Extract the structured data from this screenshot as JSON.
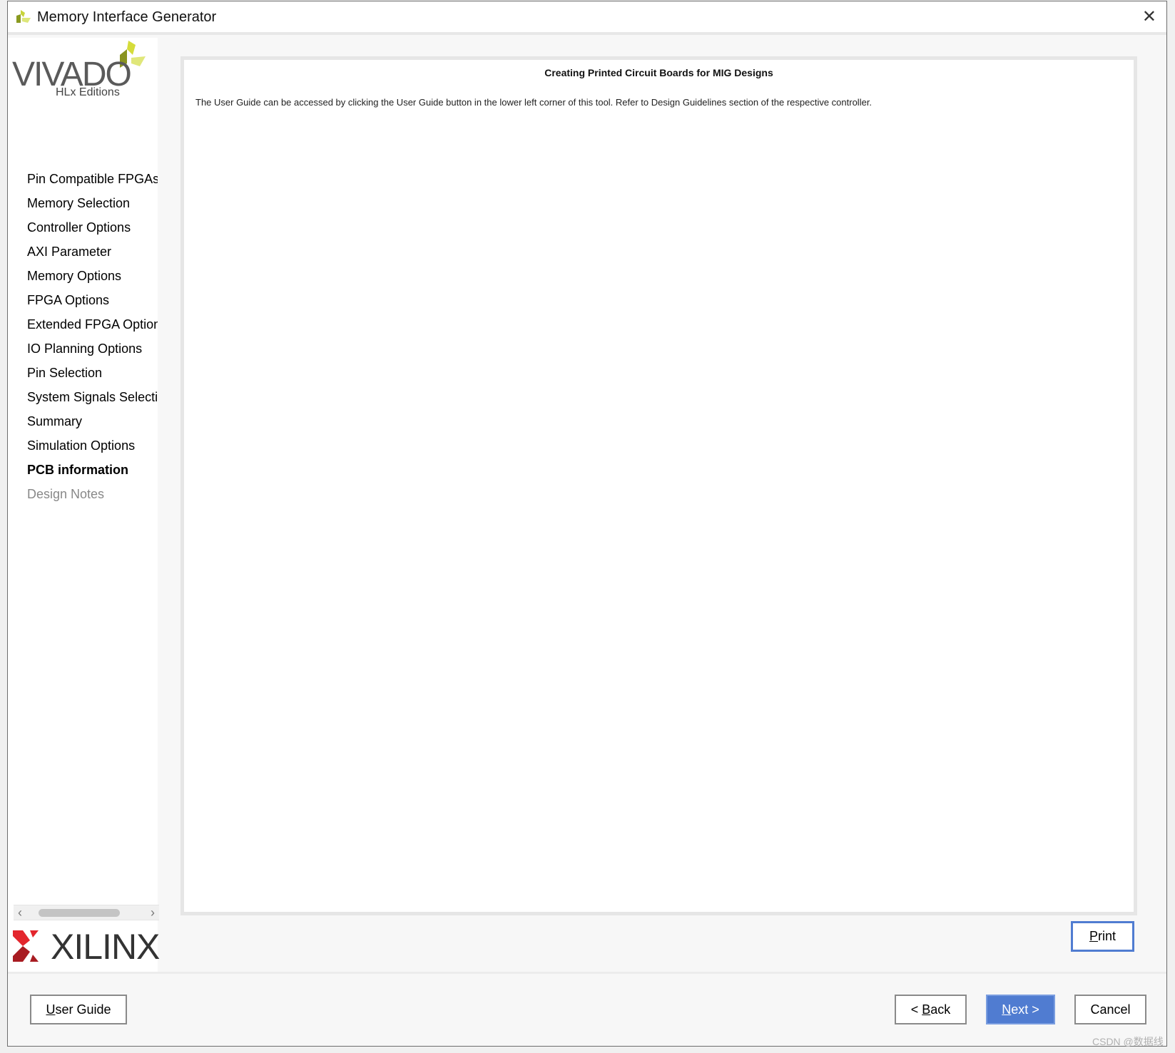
{
  "window": {
    "title": "Memory Interface Generator",
    "close_icon": "close-icon"
  },
  "branding": {
    "vivado": "VIVADO",
    "hlx": "HLx Editions",
    "xilinx": "XILINX",
    "colors": {
      "vivado_green": "#c8d43a",
      "xilinx_red": "#d8232a"
    }
  },
  "sidebar": {
    "items": [
      {
        "label": "Pin Compatible FPGAs",
        "state": "normal"
      },
      {
        "label": "Memory Selection",
        "state": "normal"
      },
      {
        "label": "Controller Options",
        "state": "normal"
      },
      {
        "label": "AXI Parameter",
        "state": "normal"
      },
      {
        "label": "Memory Options",
        "state": "normal"
      },
      {
        "label": "FPGA Options",
        "state": "normal"
      },
      {
        "label": "Extended FPGA Options",
        "state": "normal"
      },
      {
        "label": "IO Planning Options",
        "state": "normal"
      },
      {
        "label": "Pin Selection",
        "state": "normal"
      },
      {
        "label": "System Signals Selection",
        "state": "normal"
      },
      {
        "label": "Summary",
        "state": "normal"
      },
      {
        "label": "Simulation Options",
        "state": "normal"
      },
      {
        "label": "PCB information",
        "state": "current"
      },
      {
        "label": "Design Notes",
        "state": "disabled"
      }
    ]
  },
  "main": {
    "title": "Creating Printed Circuit Boards for MIG Designs",
    "body": "The User Guide can be accessed by clicking the User Guide button in the lower left corner of this tool. Refer to Design Guidelines section of the respective controller.",
    "print_label": "rint",
    "print_mnemonic": "P"
  },
  "footer": {
    "user_guide_mn": "U",
    "user_guide_rest": "ser Guide",
    "back_pre": "< ",
    "back_mn": "B",
    "back_rest": "ack",
    "next_mn": "N",
    "next_rest": "ext >",
    "cancel": "Cancel",
    "accent": "#507cd1"
  },
  "watermark": "CSDN @数据线"
}
